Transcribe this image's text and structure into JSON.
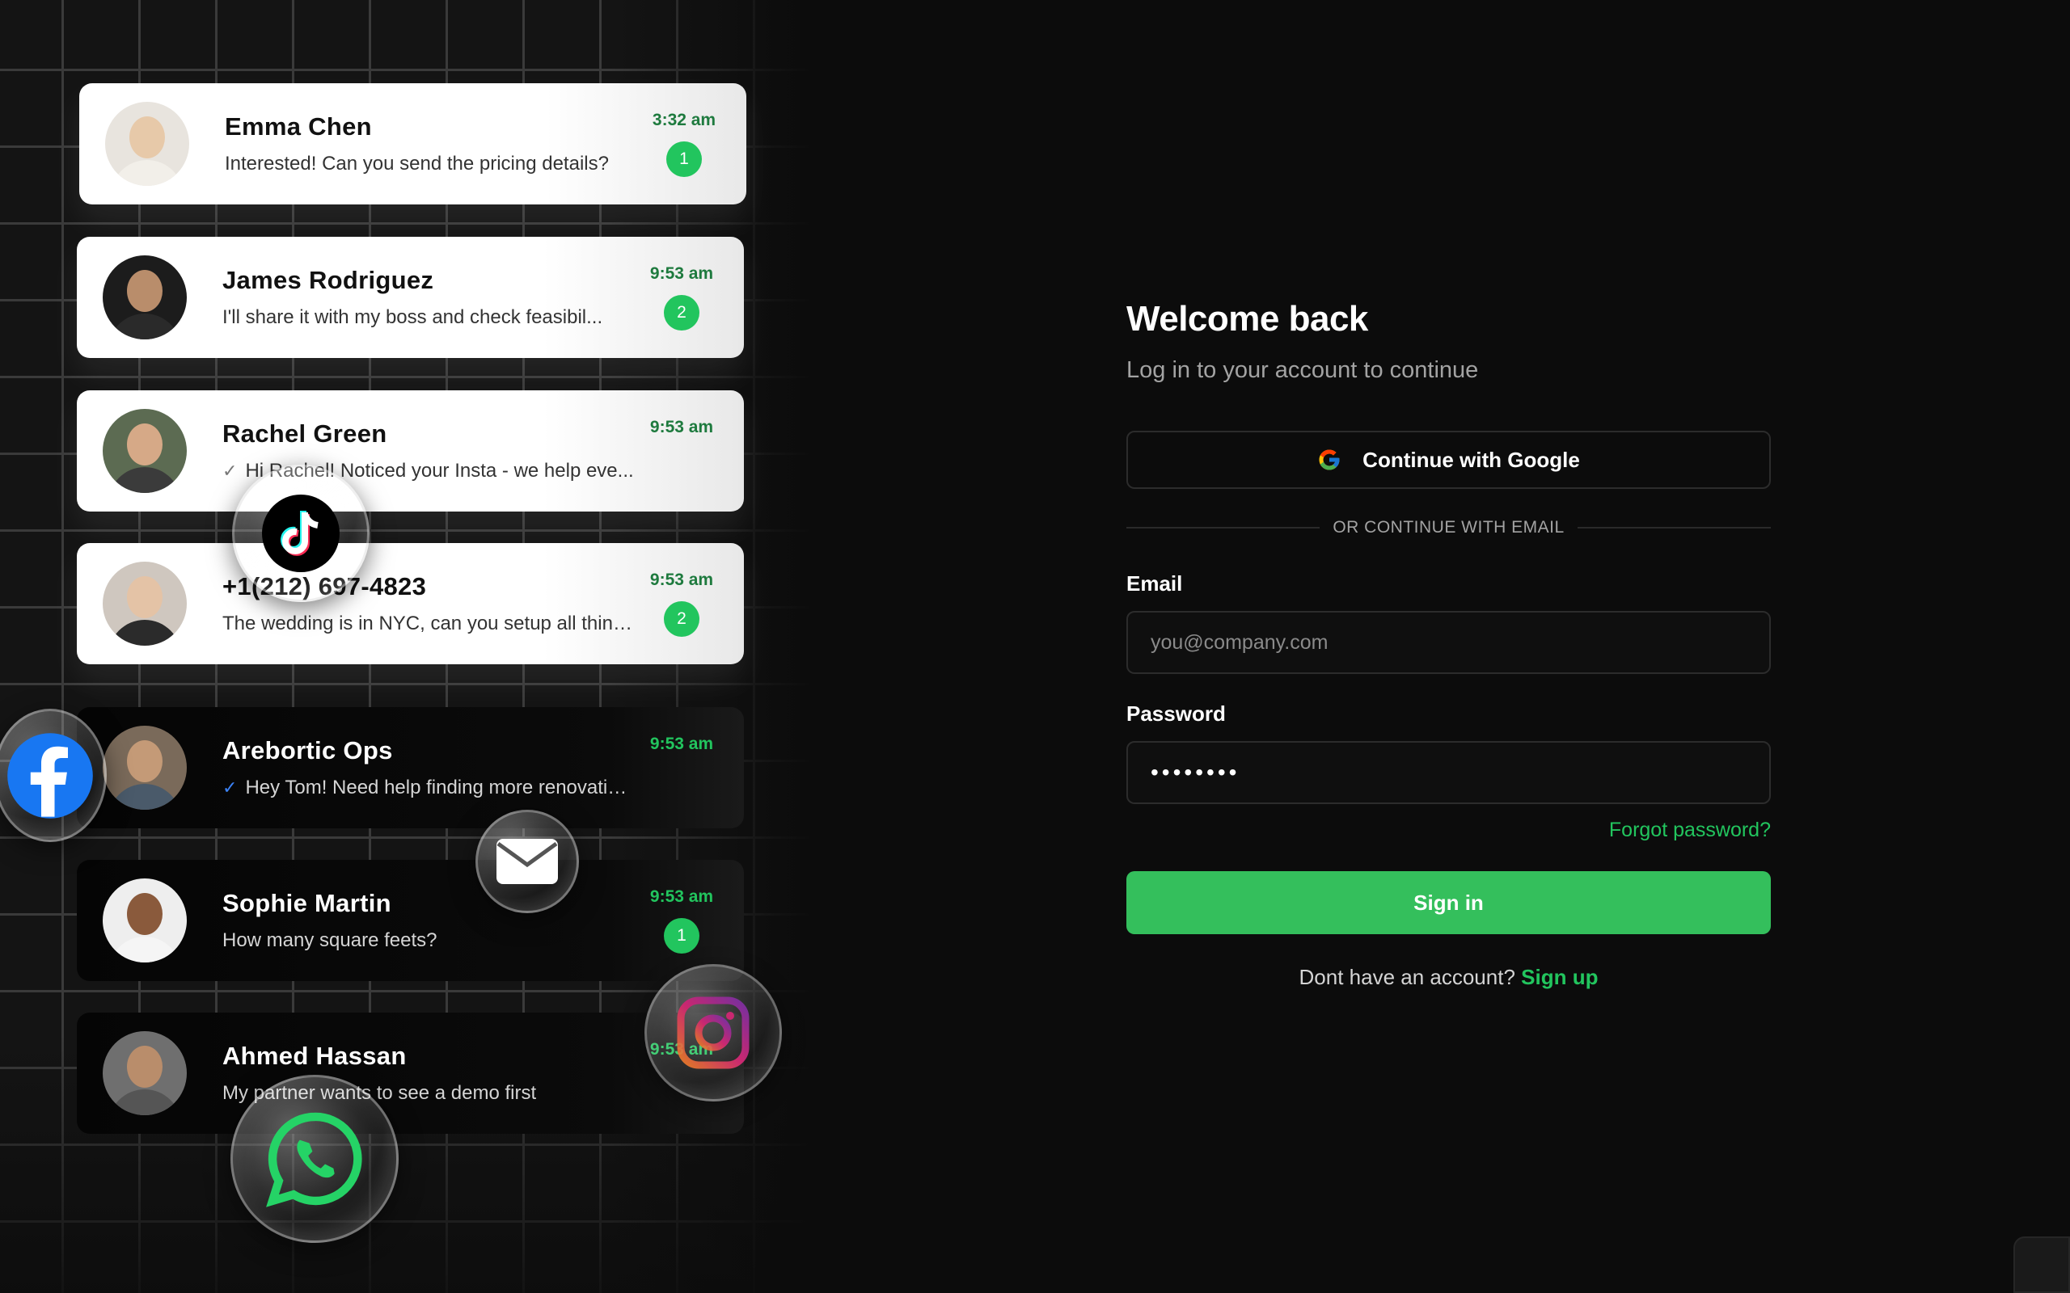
{
  "hero": {
    "conversations": [
      {
        "name": "Emma Chen",
        "message": "Interested! Can you send the pricing details?",
        "time": "3:32 am",
        "badge": "1",
        "theme": "light",
        "read_tick": false,
        "avatar_colors": {
          "bg": "#e8e4de",
          "head": "#e7c9a9",
          "body": "#f2efe9"
        }
      },
      {
        "name": "James Rodriguez",
        "message": "I'll share it with my boss and check feasibil...",
        "time": "9:53 am",
        "badge": "2",
        "theme": "light",
        "read_tick": false,
        "avatar_colors": {
          "bg": "#1c1c1c",
          "head": "#b98d6b",
          "body": "#2a2a2a"
        }
      },
      {
        "name": "Rachel Green",
        "message": "Hi Rachel! Noticed your Insta - we help eve...",
        "time": "9:53 am",
        "badge": "",
        "theme": "light",
        "read_tick": true,
        "avatar_colors": {
          "bg": "#5c6b52",
          "head": "#d6a987",
          "body": "#3b3b3b"
        }
      },
      {
        "name": "+1(212) 697-4823",
        "message": "The wedding is in NYC, can you setup all things..",
        "time": "9:53 am",
        "badge": "2",
        "theme": "light",
        "read_tick": false,
        "avatar_colors": {
          "bg": "#cfc7bf",
          "head": "#e4c3a6",
          "body": "#2b2b2b"
        }
      },
      {
        "name": "Arebortic Ops",
        "message": "Hey Tom! Need help finding more renovation cli..",
        "time": "9:53 am",
        "badge": "",
        "theme": "dark",
        "read_tick": true,
        "avatar_colors": {
          "bg": "#7a6a5a",
          "head": "#c49a77",
          "body": "#4a5a6a"
        }
      },
      {
        "name": "Sophie Martin",
        "message": "How many square feets?",
        "time": "9:53 am",
        "badge": "1",
        "theme": "dark",
        "read_tick": false,
        "avatar_colors": {
          "bg": "#eeeeee",
          "head": "#8a5a3c",
          "body": "#f5f5f5"
        }
      },
      {
        "name": "Ahmed Hassan",
        "message": "My partner wants to see a demo first",
        "time": "9:53 am",
        "badge": "",
        "theme": "dark",
        "read_tick": false,
        "avatar_colors": {
          "bg": "#6f6f6f",
          "head": "#b98d6b",
          "body": "#555555"
        }
      }
    ],
    "bubbles": [
      {
        "icon": "tiktok-icon"
      },
      {
        "icon": "facebook-icon"
      },
      {
        "icon": "mail-icon"
      },
      {
        "icon": "instagram-icon"
      },
      {
        "icon": "whatsapp-icon"
      }
    ]
  },
  "login": {
    "title": "Welcome back",
    "subtitle": "Log in to your account to continue",
    "google_button": "Continue with Google",
    "divider_text": "OR CONTINUE WITH EMAIL",
    "email_label": "Email",
    "email_placeholder": "you@company.com",
    "email_value": "",
    "password_label": "Password",
    "password_value": "••••••••",
    "forgot_link": "Forgot password?",
    "signin_button": "Sign in",
    "signup_prompt": "Dont have an account?",
    "signup_link": "Sign up"
  },
  "colors": {
    "accent": "#22c55e",
    "button_green": "#34bf5c",
    "background": "#0c0c0c"
  }
}
